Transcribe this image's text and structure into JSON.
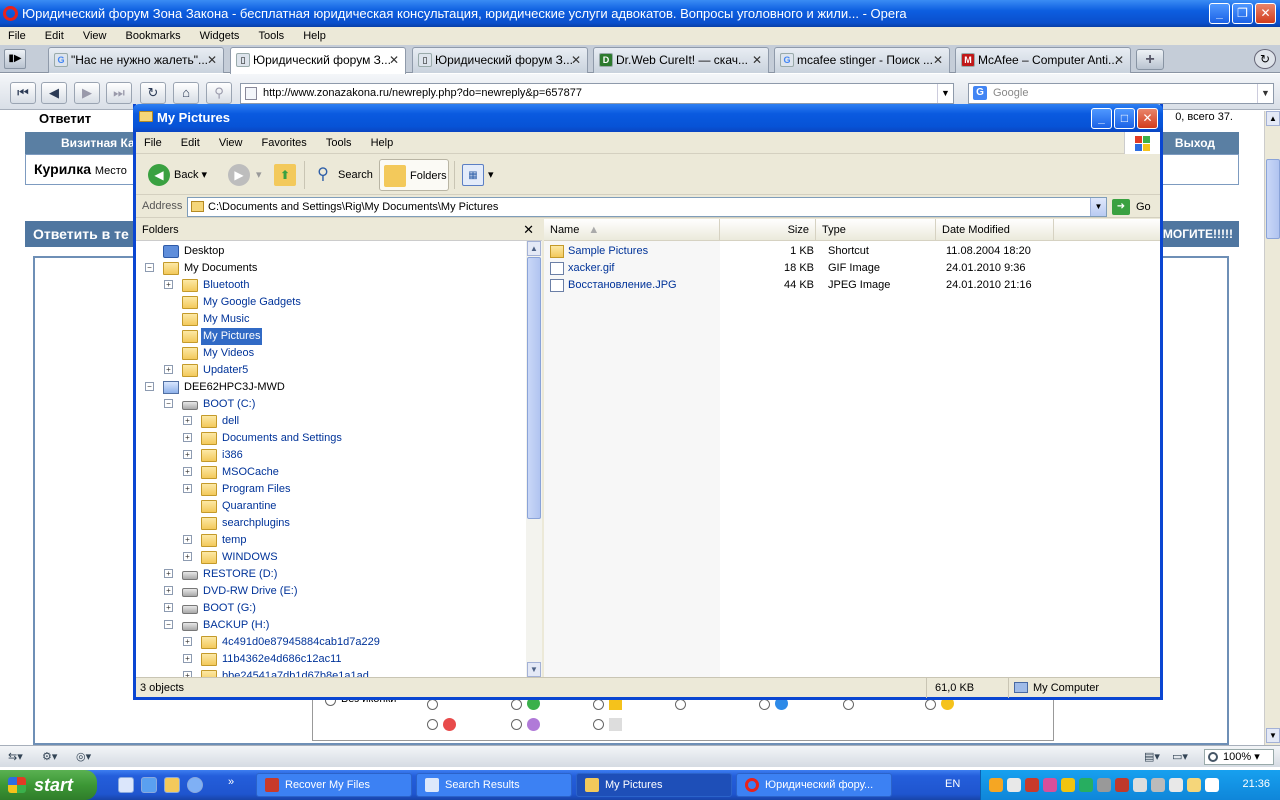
{
  "opera": {
    "title": "Юридический форум Зона Закона - бесплатная юридическая консультация, юридические услуги адвокатов. Вопросы уголовного и жили... - Opera",
    "menu": [
      "File",
      "Edit",
      "View",
      "Bookmarks",
      "Widgets",
      "Tools",
      "Help"
    ],
    "tabs": [
      {
        "label": "\"Нас не нужно жалеть\"..."
      },
      {
        "label": "Юридический форум З..."
      },
      {
        "label": "Юридический форум З..."
      },
      {
        "label": "Dr.Web CureIt! — скач..."
      },
      {
        "label": "mcafee stinger - Поиск ..."
      },
      {
        "label": "McAfee – Computer Anti..."
      }
    ],
    "address": "http://www.zonazakona.ru/newreply.php?do=newreply&p=657877",
    "search_placeholder": "Google",
    "zoom": "100%"
  },
  "forum": {
    "top_left": "Ответит",
    "top_right": "0, всего 37.",
    "bar_left": "Визитная Ка",
    "bar_right": "Выход",
    "row_title": "Курилка",
    "row_sub": "Место",
    "reply_left": "Ответить в те",
    "reply_right": "МОГИТЕ!!!!!",
    "icons_label": "Без иконки"
  },
  "explorer": {
    "title": "My Pictures",
    "menu": [
      "File",
      "Edit",
      "View",
      "Favorites",
      "Tools",
      "Help"
    ],
    "toolbar": {
      "back": "Back",
      "search": "Search",
      "folders": "Folders"
    },
    "address_label": "Address",
    "address": "C:\\Documents and Settings\\Rig\\My Documents\\My Pictures",
    "go": "Go",
    "folders_header": "Folders",
    "tree": [
      "Desktop",
      "My Documents",
      "Bluetooth",
      "My Google Gadgets",
      "My Music",
      "My Pictures",
      "My Videos",
      "Updater5",
      "DEE62HPC3J-MWD",
      "BOOT (C:)",
      "dell",
      "Documents and Settings",
      "i386",
      "MSOCache",
      "Program Files",
      "Quarantine",
      "searchplugins",
      "temp",
      "WINDOWS",
      "RESTORE (D:)",
      "DVD-RW Drive (E:)",
      "BOOT (G:)",
      "BACKUP (H:)",
      "4c491d0e87945884cab1d7a229",
      "11b4362e4d686c12ac11",
      "bbe24541a7db1d67b8e1a1ad"
    ],
    "columns": {
      "name": "Name",
      "size": "Size",
      "type": "Type",
      "date": "Date Modified"
    },
    "files": [
      {
        "name": "Sample Pictures",
        "size": "1 KB",
        "type": "Shortcut",
        "date": "11.08.2004 18:20"
      },
      {
        "name": "xacker.gif",
        "size": "18 KB",
        "type": "GIF Image",
        "date": "24.01.2010 9:36"
      },
      {
        "name": "Восстановление.JPG",
        "size": "44 KB",
        "type": "JPEG Image",
        "date": "24.01.2010 21:16"
      }
    ],
    "status": {
      "objects": "3 objects",
      "size": "61,0 KB",
      "location": "My Computer"
    }
  },
  "taskbar": {
    "start": "start",
    "tasks": [
      {
        "label": "Recover My Files"
      },
      {
        "label": "Search Results"
      },
      {
        "label": "My Pictures"
      },
      {
        "label": "Юридический фору..."
      }
    ],
    "lang": "EN",
    "clock": "21:36"
  }
}
